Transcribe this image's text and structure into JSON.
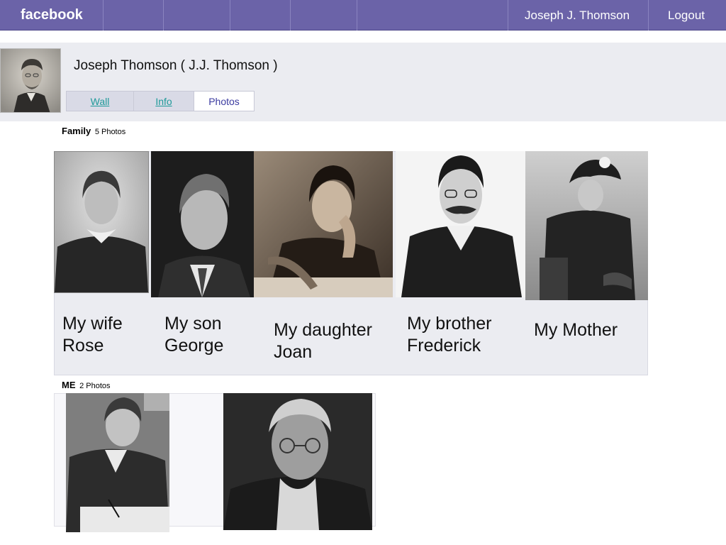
{
  "topbar": {
    "brand": "facebook",
    "user": "Joseph J. Thomson",
    "logout": "Logout"
  },
  "profile": {
    "name": "Joseph Thomson ( J.J. Thomson )",
    "tabs": [
      {
        "label": "Wall",
        "active": false
      },
      {
        "label": "Info",
        "active": false
      },
      {
        "label": "Photos",
        "active": true
      }
    ]
  },
  "albums": [
    {
      "title": "Family",
      "count": "5 Photos",
      "photos": [
        {
          "caption_line1": "My wife",
          "caption_line2": "Rose"
        },
        {
          "caption_line1": "My son",
          "caption_line2": "George"
        },
        {
          "caption_line1": "My daughter",
          "caption_line2": "Joan"
        },
        {
          "caption_line1": "My brother",
          "caption_line2": "Frederick"
        },
        {
          "caption_line1": "My Mother",
          "caption_line2": ""
        }
      ]
    },
    {
      "title": "ME",
      "count": "2 Photos"
    }
  ]
}
